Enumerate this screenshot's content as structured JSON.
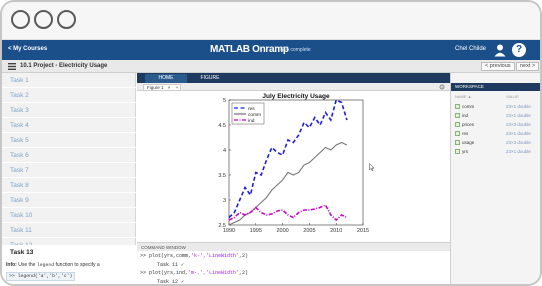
{
  "window": {
    "buttons": [
      "close",
      "minimize",
      "zoom"
    ]
  },
  "topbar": {
    "back_label": "< My Courses",
    "brand": "MATLAB Onramp",
    "progress_text": "72% complete",
    "user": "Chel Childe",
    "help": "?"
  },
  "subbar": {
    "title": "10.1 Project - Electricity Usage",
    "previous": "< previous",
    "next": "next >"
  },
  "sidebar": {
    "tasks": [
      "Task 1",
      "Task 2",
      "Task 3",
      "Task 4",
      "Task 5",
      "Task 6",
      "Task 7",
      "Task 8",
      "Task 9",
      "Task 10",
      "Task 11",
      "Task 12",
      "Task 13"
    ],
    "active_index": 12,
    "info_prefix": "Info:",
    "info_text": " Use the ",
    "info_code": "legend",
    "info_suffix": " function to specify a",
    "info_cmd": ">> legend('a','b','c')"
  },
  "main": {
    "tabs": [
      "HOME",
      "FIGURE"
    ],
    "figure_tab": "Figure 1",
    "command_window_label": "COMMAND WINDOW",
    "commands": [
      {
        "prompt": ">> ",
        "code_a": "plot(yrs,comm,",
        "str": "'k-','LineWidth'",
        "code_b": ",2)"
      },
      {
        "task": "Task 11 ✓"
      },
      {
        "prompt": ">> ",
        "code_a": "plot(yrs,ind,",
        "str": "'m-.','LineWidth'",
        "code_b": ",2)"
      },
      {
        "task": "Task 12 ✓"
      }
    ]
  },
  "workspace": {
    "title": "WORKSPACE",
    "col_name": "NAME ▲",
    "col_value": "VALUE",
    "vars": [
      {
        "name": "comm",
        "value": "23×1 double"
      },
      {
        "name": "ind",
        "value": "23×1 double"
      },
      {
        "name": "prices",
        "value": "23×3 double"
      },
      {
        "name": "res",
        "value": "23×1 double"
      },
      {
        "name": "usage",
        "value": "23×3 double"
      },
      {
        "name": "yrs",
        "value": "23×1 double"
      }
    ]
  },
  "chart_data": {
    "type": "line",
    "title": "July Electricity Usage",
    "xlim": [
      1990,
      2015
    ],
    "ylim": [
      2.5,
      5
    ],
    "xticks": [
      1990,
      1995,
      2000,
      2005,
      2010,
      2015
    ],
    "yticks": [
      2.5,
      3,
      3.5,
      4,
      4.5,
      5
    ],
    "legend_position": "top-left",
    "x": [
      1990,
      1991,
      1992,
      1993,
      1994,
      1995,
      1996,
      1997,
      1998,
      1999,
      2000,
      2001,
      2002,
      2003,
      2004,
      2005,
      2006,
      2007,
      2008,
      2009,
      2010,
      2011,
      2012
    ],
    "series": [
      {
        "name": "res",
        "color": "#1f1fd6",
        "style": "dashed",
        "values": [
          2.65,
          2.75,
          3.0,
          3.25,
          3.1,
          3.55,
          3.5,
          3.8,
          4.05,
          3.95,
          3.9,
          4.2,
          4.15,
          4.3,
          4.55,
          4.45,
          4.65,
          4.5,
          4.75,
          4.6,
          5.0,
          4.95,
          4.6
        ]
      },
      {
        "name": "comm",
        "color": "#777777",
        "style": "solid",
        "values": [
          2.5,
          2.55,
          2.6,
          2.7,
          2.75,
          2.85,
          2.95,
          3.05,
          3.2,
          3.3,
          3.4,
          3.55,
          3.5,
          3.55,
          3.7,
          3.75,
          3.85,
          3.95,
          4.05,
          4.0,
          4.1,
          4.15,
          4.1
        ]
      },
      {
        "name": "ind",
        "color": "#d000d0",
        "style": "dashdot",
        "values": [
          2.6,
          2.65,
          2.75,
          2.7,
          2.75,
          2.85,
          2.75,
          2.7,
          2.72,
          2.78,
          2.8,
          2.7,
          2.65,
          2.75,
          2.8,
          2.8,
          2.82,
          2.85,
          2.9,
          2.7,
          2.6,
          2.7,
          2.65
        ]
      }
    ]
  }
}
